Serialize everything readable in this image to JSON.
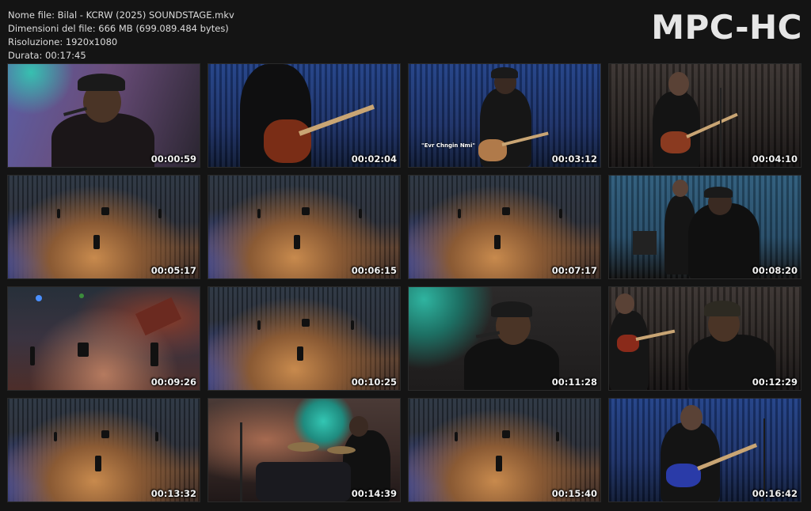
{
  "info": {
    "filename": "Nome file: Bilal - KCRW (2025) SOUNDSTAGE.mkv",
    "filesize": "Dimensioni del file: 666 MB (699.089.484 bytes)",
    "resolution": "Risoluzione: 1920x1080",
    "duration": "Durata: 00:17:45"
  },
  "logo": "MPC-HC",
  "thumbnails": [
    {
      "time": "00:00:59"
    },
    {
      "time": "00:02:04"
    },
    {
      "time": "00:03:12",
      "caption": "\"Evr Chngin Nmi\""
    },
    {
      "time": "00:04:10"
    },
    {
      "time": "00:05:17"
    },
    {
      "time": "00:06:15"
    },
    {
      "time": "00:07:17"
    },
    {
      "time": "00:08:20"
    },
    {
      "time": "00:09:26"
    },
    {
      "time": "00:10:25"
    },
    {
      "time": "00:11:28"
    },
    {
      "time": "00:12:29"
    },
    {
      "time": "00:13:32"
    },
    {
      "time": "00:14:39"
    },
    {
      "time": "00:15:40"
    },
    {
      "time": "00:16:42"
    }
  ]
}
